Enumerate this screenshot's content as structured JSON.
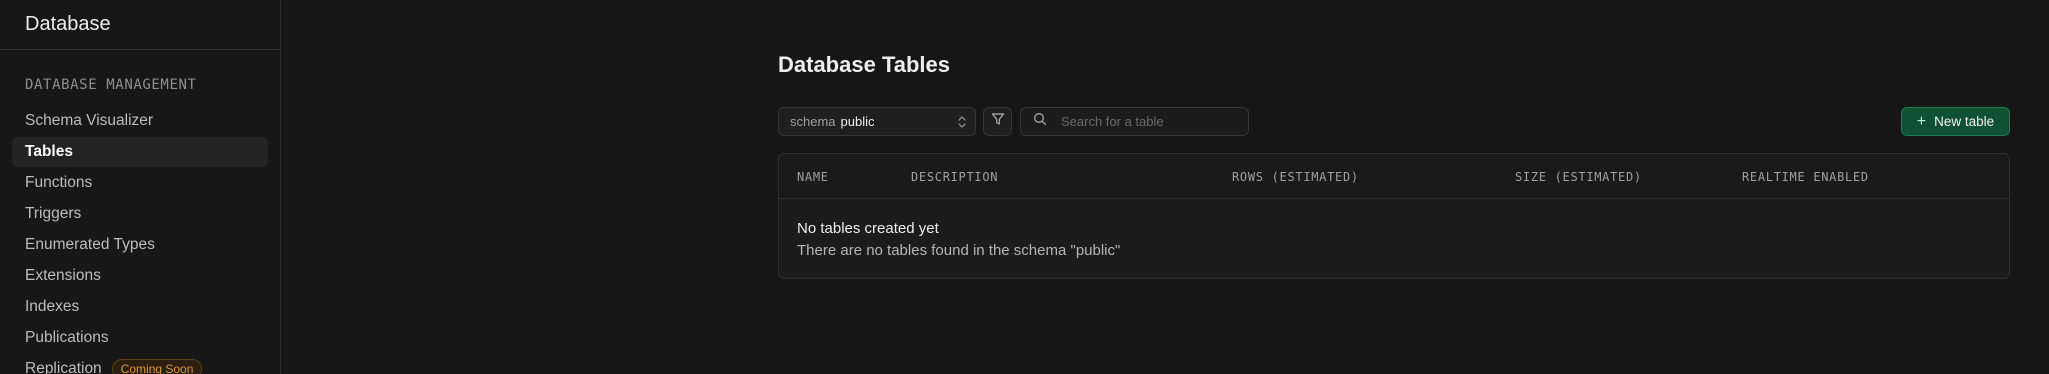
{
  "sidebar": {
    "title": "Database",
    "section": "DATABASE MANAGEMENT",
    "items": [
      {
        "label": "Schema Visualizer"
      },
      {
        "label": "Tables"
      },
      {
        "label": "Functions"
      },
      {
        "label": "Triggers"
      },
      {
        "label": "Enumerated Types"
      },
      {
        "label": "Extensions"
      },
      {
        "label": "Indexes"
      },
      {
        "label": "Publications"
      },
      {
        "label": "Replication",
        "badge": "Coming Soon"
      }
    ],
    "active_item": "Tables"
  },
  "main": {
    "title": "Database Tables",
    "schema": {
      "label": "schema",
      "value": "public"
    },
    "search": {
      "placeholder": "Search for a table",
      "value": ""
    },
    "new_table_label": "New table",
    "columns": [
      "NAME",
      "DESCRIPTION",
      "ROWS (ESTIMATED)",
      "SIZE (ESTIMATED)",
      "REALTIME ENABLED"
    ],
    "empty": {
      "title": "No tables created yet",
      "description": "There are no tables found in the schema \"public\""
    }
  },
  "colors": {
    "background": "#161616",
    "accent": "#0e5133",
    "badge": "#d69a3a"
  },
  "icons": [
    "chevron-updown-icon",
    "filter-icon",
    "search-icon",
    "plus-icon"
  ]
}
